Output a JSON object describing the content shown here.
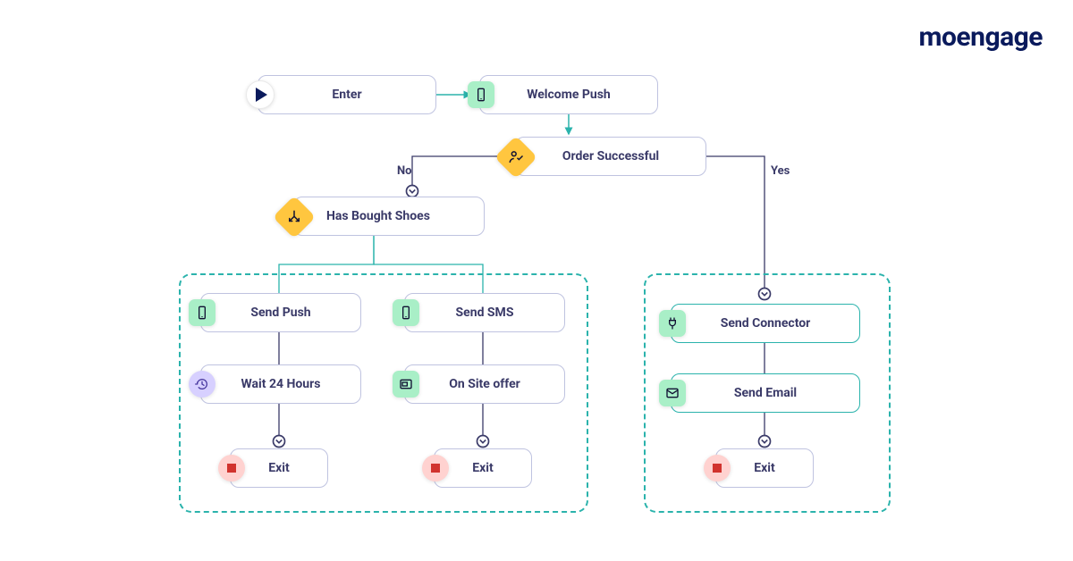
{
  "brand": "moengage",
  "colors": {
    "indigo": "#3a3a68",
    "teal": "#2bb3ac",
    "yellow": "#ffc63f",
    "green_pastel": "#a9efc7",
    "purple_pastel": "#d7d0ff",
    "red_pastel": "#ffd2d0",
    "red": "#d1332e",
    "navy": "#0a1a5c"
  },
  "branch_labels": {
    "no": "No",
    "yes": "Yes"
  },
  "nodes": {
    "enter": {
      "label": "Enter",
      "icon": "play-icon"
    },
    "welcome_push": {
      "label": "Welcome Push",
      "icon": "phone-icon"
    },
    "order_successful": {
      "label": "Order Successful",
      "icon": "person-check-icon"
    },
    "has_bought_shoes": {
      "label": "Has Bought Shoes",
      "icon": "split-arrows-icon"
    },
    "send_push": {
      "label": "Send Push",
      "icon": "phone-icon"
    },
    "send_sms": {
      "label": "Send SMS",
      "icon": "phone-icon"
    },
    "wait_24": {
      "label": "Wait 24 Hours",
      "icon": "history-icon"
    },
    "onsite_offer": {
      "label": "On Site offer",
      "icon": "inapp-icon"
    },
    "send_connector": {
      "label": "Send Connector",
      "icon": "plug-icon"
    },
    "send_email": {
      "label": "Send Email",
      "icon": "mail-icon"
    },
    "exit": {
      "label": "Exit",
      "icon": "stop-icon"
    }
  }
}
